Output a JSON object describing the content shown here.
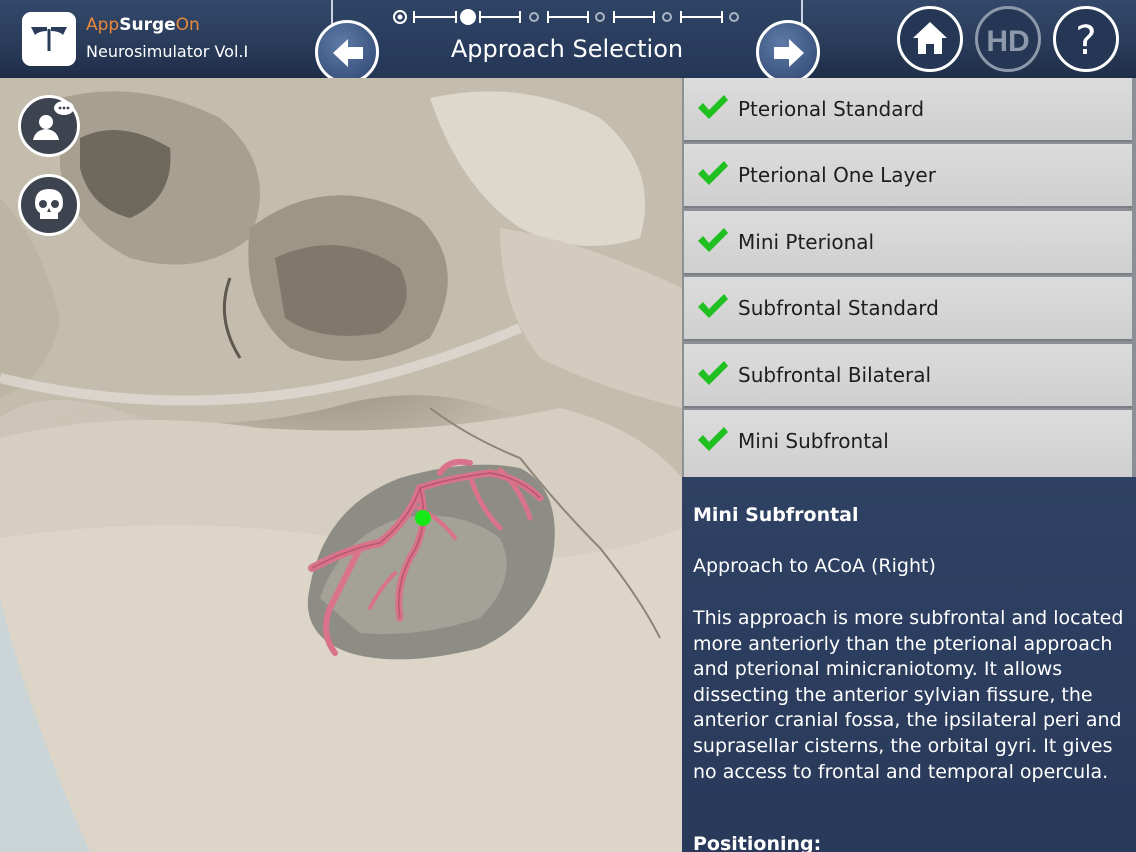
{
  "app": {
    "brand_part1": "App",
    "brand_part2": "Surge",
    "brand_part3": "On",
    "subtitle": "Neurosimulator Vol.I"
  },
  "header": {
    "title": "Approach Selection",
    "step_count": 6,
    "current_step": 2,
    "prev_icon": "arrow-left-icon",
    "next_icon": "arrow-right-icon",
    "home_icon": "home-icon",
    "hd_label": "HD",
    "help_label": "?"
  },
  "sidebar": {
    "tools": [
      {
        "icon": "surgeon-chat-icon"
      },
      {
        "icon": "skull-icon"
      }
    ]
  },
  "approaches": [
    {
      "label": "Pterional Standard",
      "checked": true
    },
    {
      "label": "Pterional One Layer",
      "checked": true
    },
    {
      "label": "Mini Pterional",
      "checked": true
    },
    {
      "label": "Subfrontal Standard",
      "checked": true
    },
    {
      "label": "Subfrontal Bilateral",
      "checked": true
    },
    {
      "label": "Mini Subfrontal",
      "checked": true
    }
  ],
  "description": {
    "title": "Mini Subfrontal",
    "subtitle": "Approach to ACoA (Right)",
    "body": "This approach is more subfrontal and located more anteriorly than the pterional approach and pterional minicraniotomy. It allows dissecting the anterior sylvian fissure, the anterior cranial fossa, the ipsilateral peri and suprasellar cisterns, the orbital gyri. It gives no access to frontal and temporal opercula.",
    "positioning_heading": "Positioning:"
  },
  "colors": {
    "header_bg": "#2a3c5a",
    "brand_accent": "#e8893b",
    "check_green": "#1fc01f",
    "list_item_bg": "#d6d6d6",
    "panel_bg": "#2c3e5e",
    "vessel_pink": "#d9738c",
    "target_green": "#17e817"
  }
}
